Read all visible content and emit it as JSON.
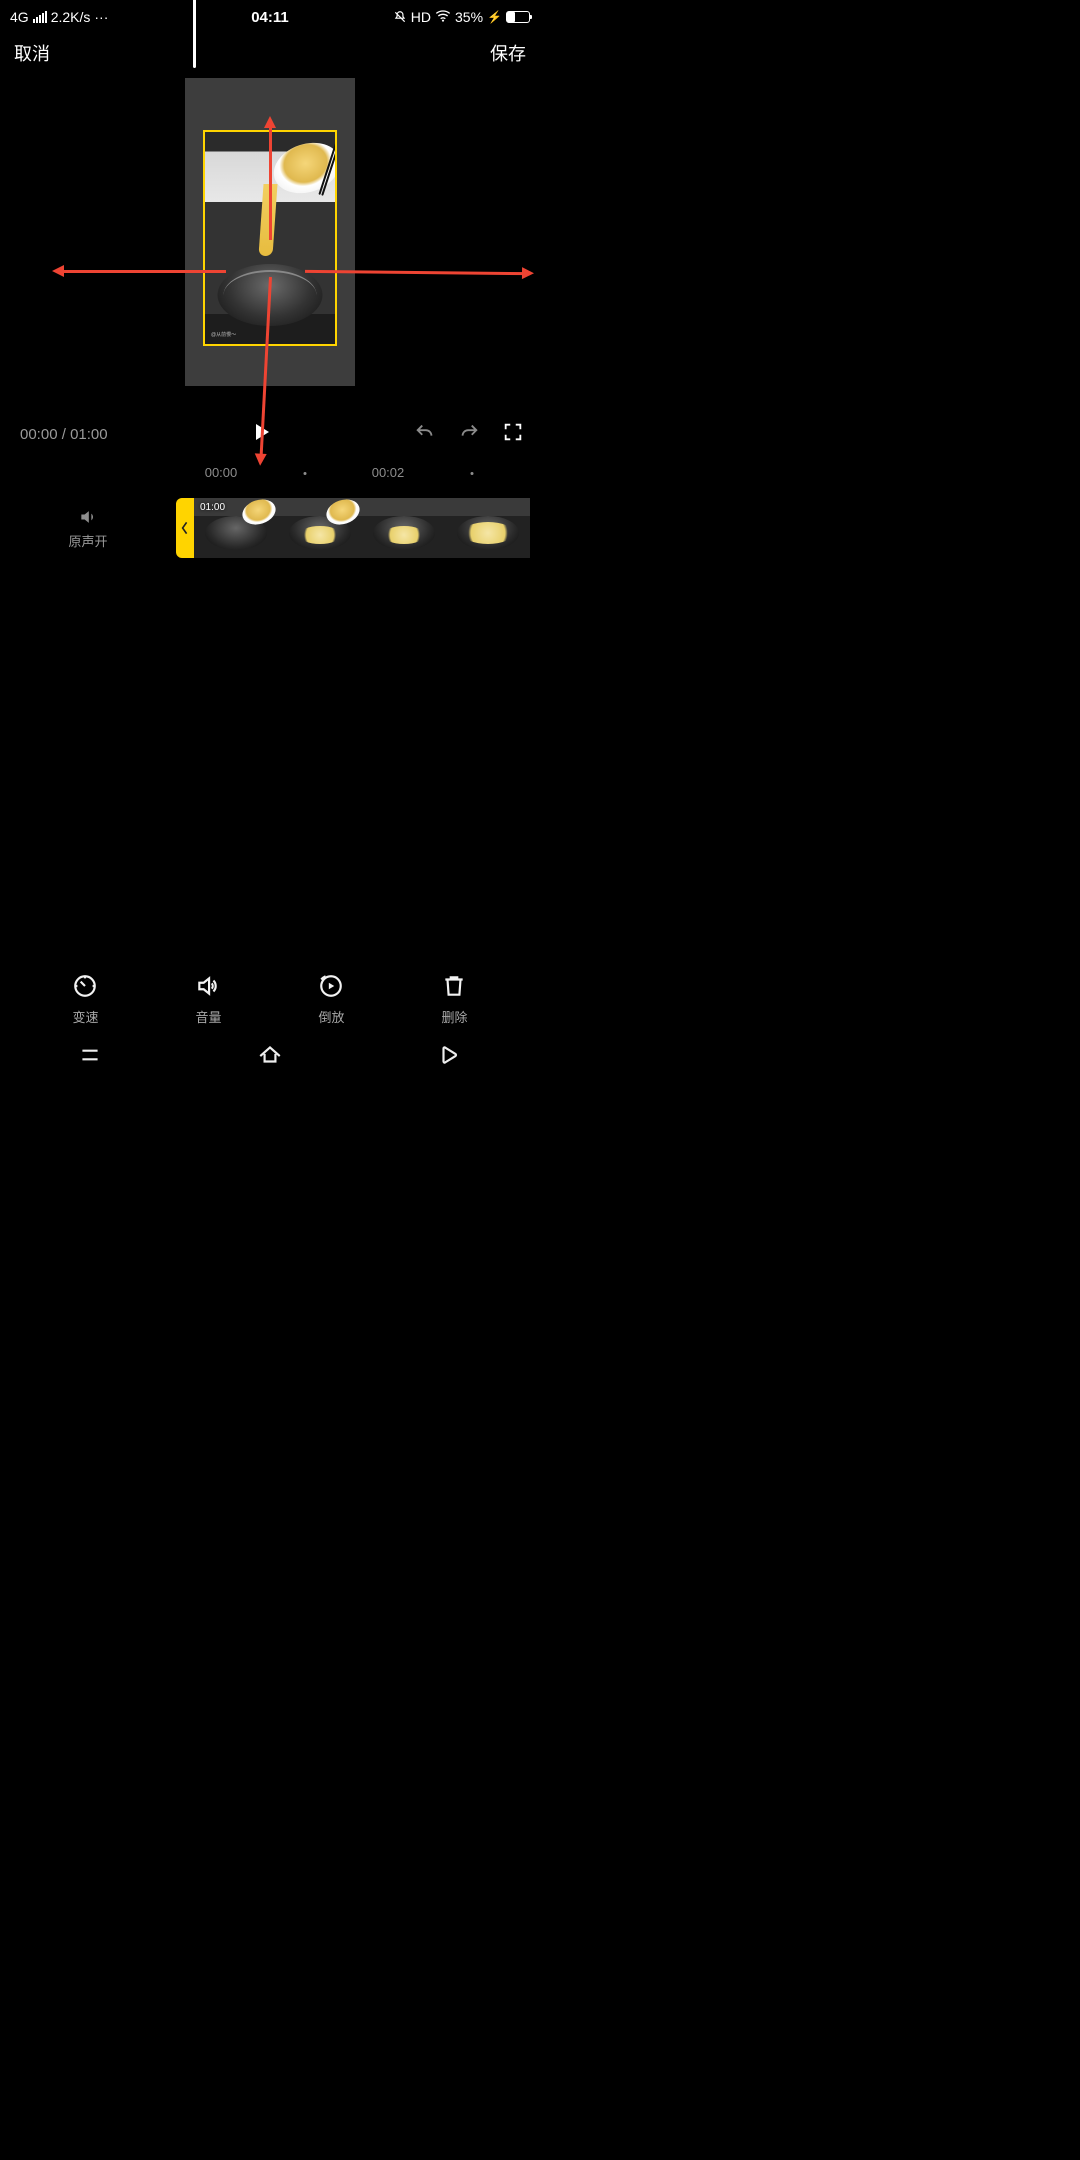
{
  "status": {
    "network": "4G",
    "speed": "2.2K/s",
    "more": "···",
    "time": "04:11",
    "hd": "HD",
    "battery_pct": "35%"
  },
  "titlebar": {
    "cancel": "取消",
    "save": "保存"
  },
  "preview": {
    "watermark": "@从前慢～"
  },
  "playback": {
    "current": "00:00",
    "separator": " / ",
    "total": "01:00"
  },
  "ruler": {
    "t0": "00:00",
    "t1": "00:02"
  },
  "timeline": {
    "audio_label": "原声开",
    "clip_duration": "01:00"
  },
  "tools": {
    "speed": "变速",
    "volume": "音量",
    "reverse": "倒放",
    "delete": "删除"
  }
}
